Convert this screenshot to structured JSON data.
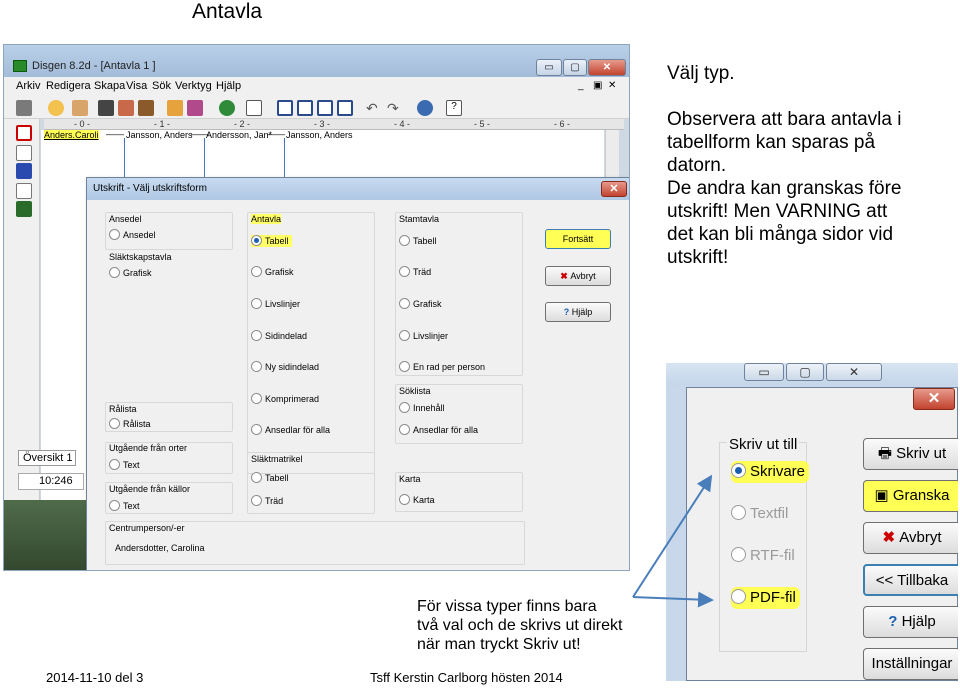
{
  "slide": {
    "title": "Antavla",
    "notes": [
      "Välj typ.",
      "",
      "Observera att bara antavla i",
      "tabellform kan sparas på",
      "datorn.",
      "De andra kan granskas före",
      "utskrift! Men VARNING att",
      "det kan bli många sidor vid",
      "utskrift!"
    ],
    "caption": [
      "För vissa typer finns bara",
      "två val och de skrivs ut direkt",
      "när man tryckt Skriv ut!"
    ],
    "footer_left": "2014-11-10 del 3",
    "footer_center": "Tsff Kerstin Carlborg hösten 2014"
  },
  "app": {
    "title": "Disgen 8.2d - [Antavla 1 ]",
    "menu": [
      "Arkiv",
      "Redigera",
      "Skapa",
      "Visa",
      "Sök",
      "Verktyg",
      "Hjälp"
    ],
    "ruler": [
      "- 0 -",
      "- 1 -",
      "- 2 -",
      "- 3 -",
      "- 4 -",
      "- 5 -",
      "- 6 -"
    ],
    "people": [
      "Anders.Caroli",
      "Jansson, Anders",
      "Andersson, Jan*",
      "Jansson, Anders"
    ],
    "tab": "Översikt 1",
    "status": "10:246",
    "window_buttons": [
      "▭",
      "▢",
      "✕"
    ]
  },
  "dialog": {
    "title": "Utskrift - Välj utskriftsform",
    "close": "✕",
    "groups": {
      "ansedel": {
        "label": "Ansedel",
        "options": [
          "Ansedel"
        ]
      },
      "slaktskapstavla": {
        "label": "Släktskapstavla",
        "options": [
          "Grafisk"
        ]
      },
      "ralista": {
        "label": "Rålista",
        "options": [
          "Rålista"
        ]
      },
      "orter": {
        "label": "Utgående från orter",
        "options": [
          "Text"
        ]
      },
      "kallor": {
        "label": "Utgående från källor",
        "options": [
          "Text"
        ]
      },
      "centrumperson": {
        "label": "Centrumperson/-er",
        "value": "Andersdotter, Carolina"
      },
      "antavla": {
        "label": "Antavla",
        "options": [
          "Tabell",
          "Grafisk",
          "Livslinjer",
          "Sidindelad",
          "Ny sidindelad",
          "Komprimerad",
          "Ansedlar för alla"
        ],
        "selected": "Tabell"
      },
      "slaktmatrikel": {
        "label": "Släktmatrikel",
        "options": [
          "Tabell",
          "Träd"
        ]
      },
      "stamtavla": {
        "label": "Stamtavla",
        "options": [
          "Tabell",
          "Träd",
          "Grafisk",
          "Livslinjer",
          "En rad per person"
        ]
      },
      "soklista": {
        "label": "Söklista",
        "options": [
          "Innehåll",
          "Ansedlar för alla"
        ]
      },
      "karta": {
        "label": "Karta",
        "options": [
          "Karta"
        ]
      }
    },
    "buttons": {
      "continue": "Fortsätt",
      "cancel": "Avbryt",
      "help": "Hjälp"
    }
  },
  "zoom": {
    "group_label": "Skriv ut till",
    "options": [
      "Skrivare",
      "Textfil",
      "RTF-fil",
      "PDF-fil"
    ],
    "selected": "Skrivare",
    "buttons": [
      "Skriv ut",
      "Granska",
      "Avbryt",
      "<< Tillbaka",
      "Hjälp",
      "Inställningar"
    ],
    "window_buttons": [
      "▭",
      "▢",
      "✕"
    ],
    "close": "✕"
  },
  "colors": {
    "highlight": "#ffff55",
    "arrow": "#4a7ebb",
    "selected_radio": "#1c5fb0"
  }
}
